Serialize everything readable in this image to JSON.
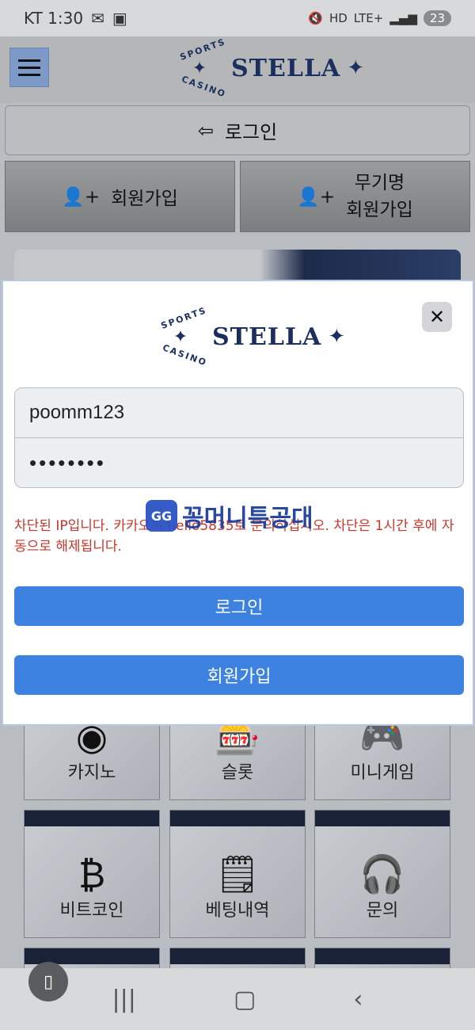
{
  "status_bar": {
    "carrier_time": "KT 1:30",
    "network": "LTE+",
    "hd": "HD",
    "battery": "23"
  },
  "header": {
    "logo_text": "STELLA",
    "logo_arc_top": "SPORTS",
    "logo_arc_bottom": "CASINO"
  },
  "background_page": {
    "login_label": "로그인",
    "join_label": "회원가입",
    "anon_join_line1": "무기명",
    "anon_join_line2": "회원가입"
  },
  "modal": {
    "logo_text": "STELLA",
    "username_value": "poomm123",
    "password_masked": "••••••••",
    "error_message": "차단된 IP입니다. 카카오톡 hello5835로 문의하십시오. 차단은 1시간 후에 자동으로 해제됩니다.",
    "login_button": "로그인",
    "join_button": "회원가입",
    "close_icon": "✕"
  },
  "watermark": {
    "text": "꽁머니특공대"
  },
  "grid": {
    "tiles": [
      {
        "label": "카지노",
        "icon": "casino-chip-icon"
      },
      {
        "label": "슬롯",
        "icon": "slot-machine-icon"
      },
      {
        "label": "미니게임",
        "icon": "gamepad-icon"
      },
      {
        "label": "비트코인",
        "icon": "bitcoin-coins-icon"
      },
      {
        "label": "베팅내역",
        "icon": "notes-icon"
      },
      {
        "label": "문의",
        "icon": "support-agent-icon"
      }
    ]
  },
  "colors": {
    "primary_button": "#3d82e0",
    "error_text": "#c9352b",
    "logo_navy": "#1b2f5e"
  }
}
